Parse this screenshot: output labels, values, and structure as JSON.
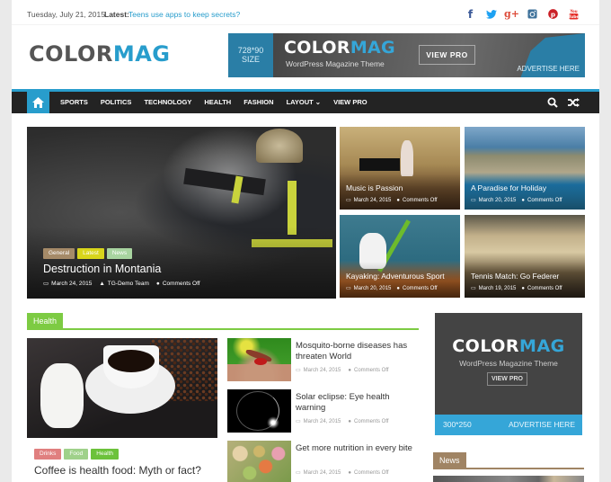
{
  "topbar": {
    "date": "Tuesday, July 21, 2015",
    "latest_label": "Latest:",
    "latest_link": "Teens use apps to keep secrets?",
    "social_icons": [
      {
        "name": "facebook-icon",
        "glyph": "f",
        "color": "#3b5998"
      },
      {
        "name": "twitter-icon",
        "glyph": "🐦",
        "color": "#1da1f2"
      },
      {
        "name": "google-plus-icon",
        "glyph": "g+",
        "color": "#dd4b39"
      },
      {
        "name": "instagram-icon",
        "glyph": "◙",
        "color": "#3f729b"
      },
      {
        "name": "pinterest-icon",
        "glyph": "℗",
        "color": "#cb2027"
      },
      {
        "name": "youtube-icon",
        "glyph": "▶",
        "color": "#e52d27"
      }
    ]
  },
  "header": {
    "logo_part1": "COLOR",
    "logo_part2": "MAG",
    "banner": {
      "size_line1": "728*90",
      "size_line2": "SIZE",
      "brand_part1": "COLOR",
      "brand_part2": "MAG",
      "subtitle": "WordPress Magazine Theme",
      "view_pro": "VIEW PRO",
      "advertise": "ADVERTISE HERE"
    }
  },
  "nav": {
    "items": [
      "SPORTS",
      "POLITICS",
      "TECHNOLOGY",
      "HEALTH",
      "FASHION",
      "LAYOUT ⌄",
      "VIEW PRO"
    ],
    "accent": "#289dcc"
  },
  "featured": {
    "hero": {
      "tags": [
        {
          "label": "General",
          "color": "#a58a68"
        },
        {
          "label": "Latest",
          "color": "#d8d51b"
        },
        {
          "label": "News",
          "color": "#a8d4a0"
        }
      ],
      "title": "Destruction in Montania",
      "date": "March 24, 2015",
      "author": "TG-Demo Team",
      "comments": "Comments Off"
    },
    "tiles": [
      {
        "title": "Music is Passion",
        "date": "March 24, 2015",
        "comments": "Comments Off"
      },
      {
        "title": "A Paradise for Holiday",
        "date": "March 20, 2015",
        "comments": "Comments Off"
      },
      {
        "title": "Kayaking: Adventurous Sport",
        "date": "March 20, 2015",
        "comments": "Comments Off"
      },
      {
        "title": "Tennis Match: Go Federer",
        "date": "March 19, 2015",
        "comments": "Comments Off"
      }
    ]
  },
  "health": {
    "heading": "Health",
    "color": "#7dcb43",
    "main": {
      "tags": [
        {
          "label": "Drinks",
          "color": "#e07f7f"
        },
        {
          "label": "Food",
          "color": "#9fd18a"
        },
        {
          "label": "Health",
          "color": "#6cc23b"
        }
      ],
      "title": "Coffee is health food: Myth or fact?"
    },
    "list": [
      {
        "title": "Mosquito-borne diseases has threaten World",
        "date": "March 24, 2015",
        "comments": "Comments Off"
      },
      {
        "title": "Solar eclipse: Eye health warning",
        "date": "March 24, 2015",
        "comments": "Comments Off"
      },
      {
        "title": "Get more nutrition in every bite",
        "date": "March 24, 2015",
        "comments": "Comments Off"
      }
    ]
  },
  "sidebar": {
    "ad": {
      "brand_part1": "COLOR",
      "brand_part2": "MAG",
      "subtitle": "WordPress Magazine Theme",
      "view_pro": "VIEW PRO",
      "size": "300*250",
      "advertise": "ADVERTISE HERE"
    },
    "news_heading": "News"
  }
}
